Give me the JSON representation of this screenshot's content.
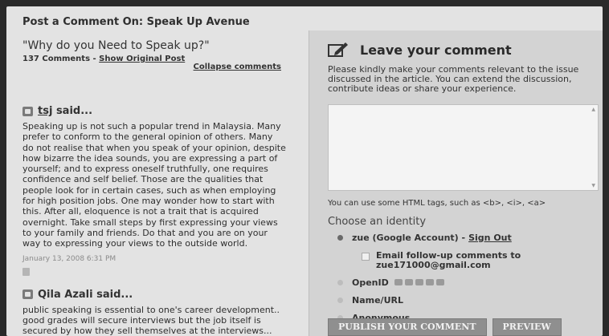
{
  "post": {
    "header": "Post a Comment On: Speak Up Avenue",
    "title": "\"Why do you Need to Speak up?\"",
    "comment_count": "137 Comments",
    "separator": " - ",
    "show_original": "Show Original Post",
    "collapse": "Collapse comments"
  },
  "comments": [
    {
      "author": "tsj",
      "said": " said...",
      "text": "Speaking up is not such a popular trend in Malaysia. Many prefer to conform to the general opinion of others. Many do not realise that when you speak of your opinion, despite how bizarre the idea sounds, you are expressing a part of yourself; and to express oneself truthfully, one requires confidence and self belief. Those are the qualities that people look for in certain cases, such as when employing for high position jobs. One may wonder how to start with this. After all, eloquence is not a trait that is acquired overnight. Take small steps by first expressing your views to your family and friends. Do that and you are on your way to expressing your views to the outside world.",
      "date": "January 13, 2008 6:31 PM"
    },
    {
      "author": "Qila Azali",
      "said": " said...",
      "text": "public speaking is essential to one's career development.. good grades will secure interviews but the job itself is secured by how they sell themselves at the interviews... therefore if"
    }
  ],
  "form": {
    "title": "Leave your comment",
    "intro": "Please kindly make your comments relevant to the issue discussed in the article. You can extend the discussion, contribute ideas or share your experience.",
    "textarea_value": "",
    "html_note": "You can use some HTML tags, such as <b>, <i>, <a>",
    "identity_heading": "Choose an identity",
    "google_label": "zue (Google Account) -",
    "sign_out": "Sign Out",
    "email_label": "Email follow-up comments to",
    "email": "zue171000@gmail.com",
    "openid_label": "OpenID",
    "name_url_label": "Name/URL",
    "anonymous_label": "Anonymous",
    "publish_label": "PUBLISH YOUR COMMENT",
    "preview_label": "PREVIEW"
  }
}
